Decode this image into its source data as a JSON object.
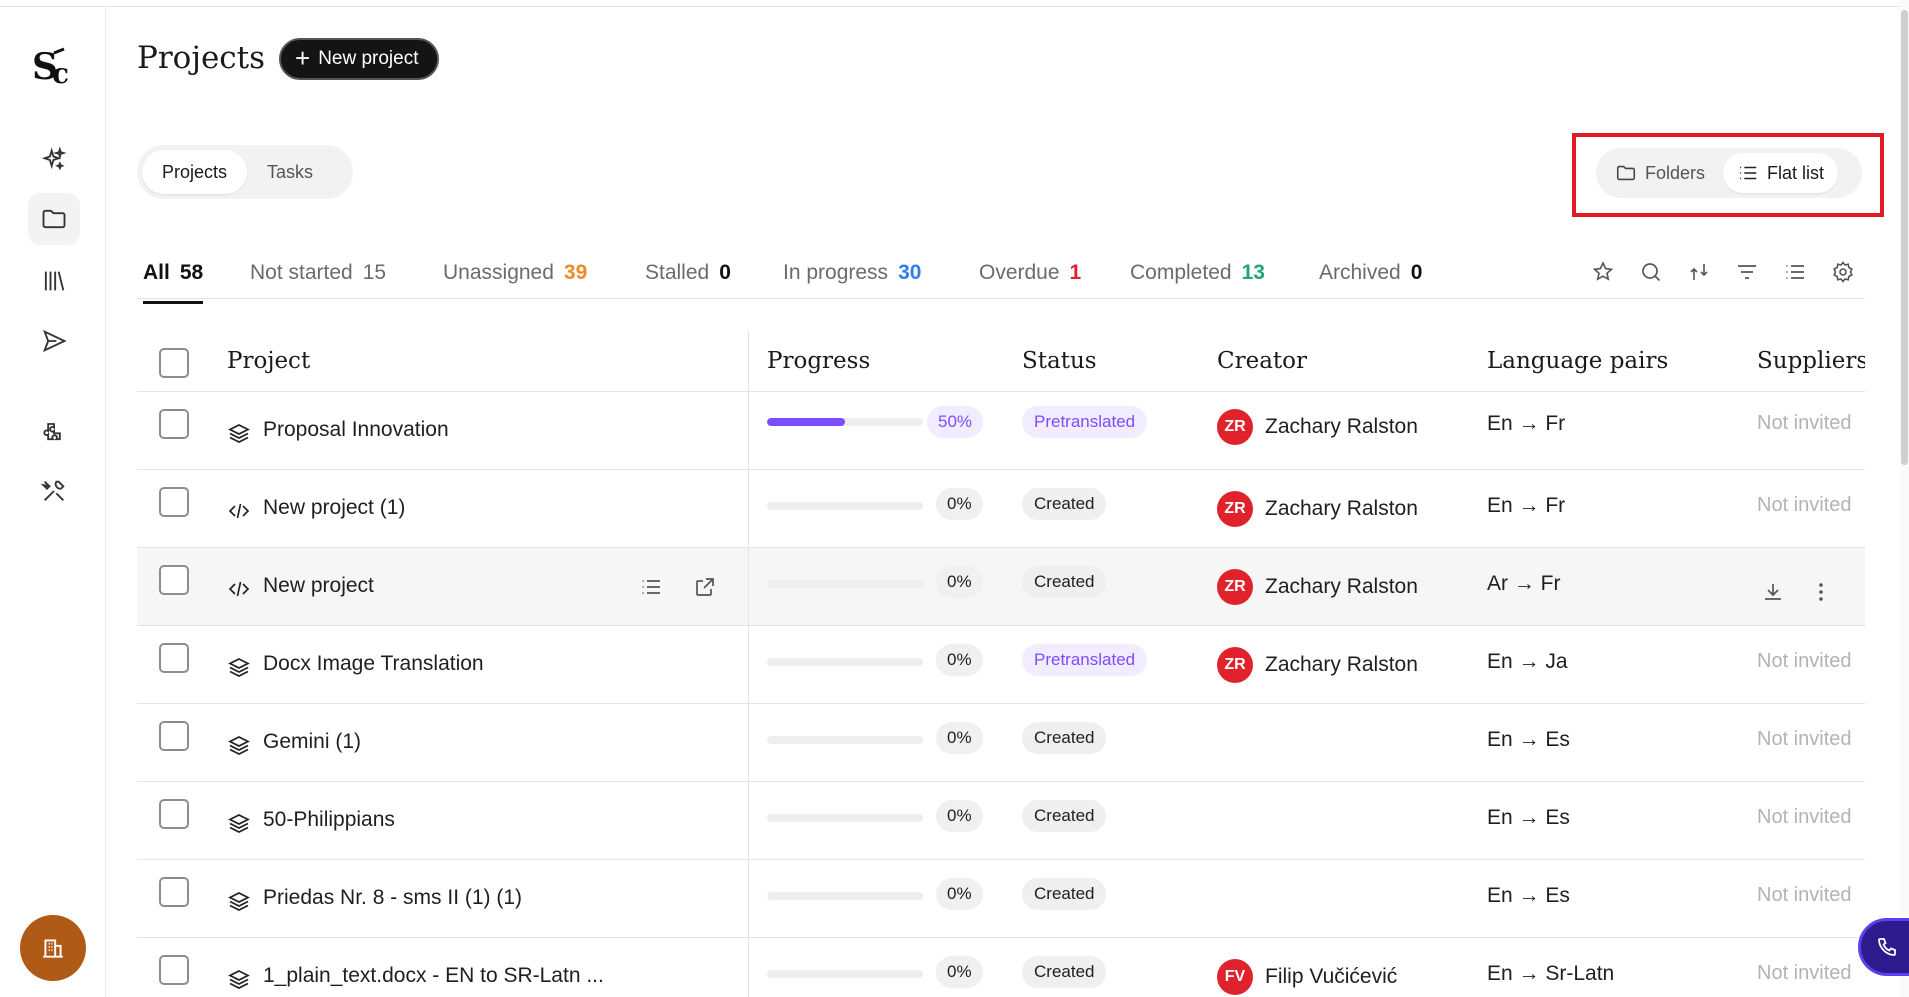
{
  "header": {
    "title": "Projects",
    "new_project_label": "New project"
  },
  "view_tabs": [
    "Projects",
    "Tasks"
  ],
  "view_toggle": {
    "folders_label": "Folders",
    "flat_list_label": "Flat list"
  },
  "status_tabs": [
    {
      "label": "All",
      "count": "58",
      "color": "#111111"
    },
    {
      "label": "Not started",
      "count": "15",
      "color": "#6b6b6b"
    },
    {
      "label": "Unassigned",
      "count": "39",
      "color": "#f08a24"
    },
    {
      "label": "Stalled",
      "count": "0",
      "color": "#111111"
    },
    {
      "label": "In progress",
      "count": "30",
      "color": "#2f80ed"
    },
    {
      "label": "Overdue",
      "count": "1",
      "color": "#e0222c"
    },
    {
      "label": "Completed",
      "count": "13",
      "color": "#1fa67a"
    },
    {
      "label": "Archived",
      "count": "0",
      "color": "#111111"
    }
  ],
  "toolbar_icons": [
    "star-icon",
    "search-icon",
    "sort-icon",
    "filter-icon",
    "list-settings-icon",
    "gear-icon"
  ],
  "table": {
    "columns": [
      "Project",
      "Progress",
      "Status",
      "Creator",
      "Language pairs",
      "Suppliers"
    ],
    "rows": [
      {
        "name": "Proposal Innovation",
        "icon": "layers-icon",
        "progress": 0.5,
        "progress_label": "50%",
        "status": "Pretranslated",
        "initials": "ZR",
        "creator": "Zachary Ralston",
        "languages": "En → Fr",
        "suppliers": "Not invited"
      },
      {
        "name": "New project (1)",
        "icon": "code-icon",
        "progress": 0,
        "progress_label": "0%",
        "status": "Created",
        "initials": "ZR",
        "creator": "Zachary Ralston",
        "languages": "En → Fr",
        "suppliers": "Not invited"
      },
      {
        "name": "New project",
        "icon": "code-icon",
        "progress": 0,
        "progress_label": "0%",
        "status": "Created",
        "initials": "ZR",
        "creator": "Zachary Ralston",
        "languages": "Ar → Fr",
        "suppliers": ""
      },
      {
        "name": "Docx Image Translation",
        "icon": "layers-icon",
        "progress": 0,
        "progress_label": "0%",
        "status": "Pretranslated",
        "initials": "ZR",
        "creator": "Zachary Ralston",
        "languages": "En → Ja",
        "suppliers": "Not invited"
      },
      {
        "name": "Gemini (1)",
        "icon": "layers-icon",
        "progress": 0,
        "progress_label": "0%",
        "status": "Created",
        "initials": "",
        "creator": "",
        "languages": "En → Es",
        "suppliers": "Not invited"
      },
      {
        "name": "50-Philippians",
        "icon": "layers-icon",
        "progress": 0,
        "progress_label": "0%",
        "status": "Created",
        "initials": "",
        "creator": "",
        "languages": "En → Es",
        "suppliers": "Not invited"
      },
      {
        "name": "Priedas Nr. 8 - sms II (1) (1)",
        "icon": "layers-icon",
        "progress": 0,
        "progress_label": "0%",
        "status": "Created",
        "initials": "",
        "creator": "",
        "languages": "En → Es",
        "suppliers": "Not invited"
      },
      {
        "name": "1_plain_text.docx - EN to SR-Latn ...",
        "icon": "layers-icon",
        "progress": 0,
        "progress_label": "0%",
        "status": "Created",
        "initials": "FV",
        "creator": "Filip Vučićević",
        "languages": "En → Sr-Latn",
        "suppliers": "Not invited"
      }
    ]
  },
  "colors": {
    "accent": "#7c4dff",
    "avatar": "#e0222c",
    "highlight": "#e01b24",
    "org_button": "#b05a18"
  }
}
